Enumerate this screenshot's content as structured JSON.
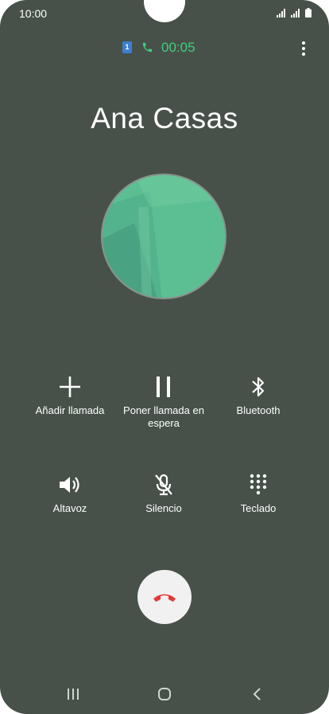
{
  "status_bar": {
    "time": "10:00"
  },
  "call": {
    "sim_label": "1",
    "timer": "00:05",
    "contact_name": "Ana Casas"
  },
  "actions": [
    {
      "label": "Añadir llamada",
      "icon": "plus-icon"
    },
    {
      "label": "Poner llamada en espera",
      "icon": "pause-icon"
    },
    {
      "label": "Bluetooth",
      "icon": "bluetooth-icon"
    },
    {
      "label": "Altavoz",
      "icon": "speaker-icon"
    },
    {
      "label": "Silencio",
      "icon": "mic-off-icon"
    },
    {
      "label": "Teclado",
      "icon": "keypad-icon"
    }
  ],
  "end_call": {
    "icon": "end-call-icon",
    "color": "#e53935"
  },
  "nav": {
    "recents_icon": "recents-icon",
    "home_icon": "home-icon",
    "back_icon": "back-icon"
  },
  "colors": {
    "background": "#47514a",
    "accent": "#3fcf7c"
  }
}
